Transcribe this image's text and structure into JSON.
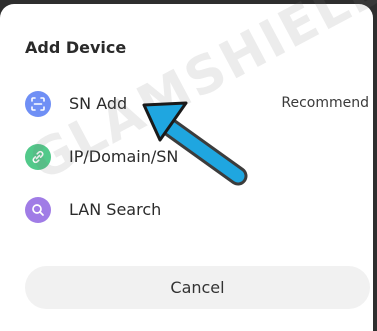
{
  "dialog": {
    "title": "Add Device",
    "items": [
      {
        "label": "SN Add",
        "icon": "scan-icon",
        "icon_color": "#6f8ff5",
        "badge": "Recommend"
      },
      {
        "label": "IP/Domain/SN",
        "icon": "link-icon",
        "icon_color": "#52c98a"
      },
      {
        "label": "LAN Search",
        "icon": "search-icon",
        "icon_color": "#a07ce6"
      }
    ],
    "cancel_label": "Cancel"
  },
  "watermark": "GLAMSHIELD",
  "pointer": {
    "icon": "arrow-pointer-icon",
    "color": "#1fa6e0"
  }
}
